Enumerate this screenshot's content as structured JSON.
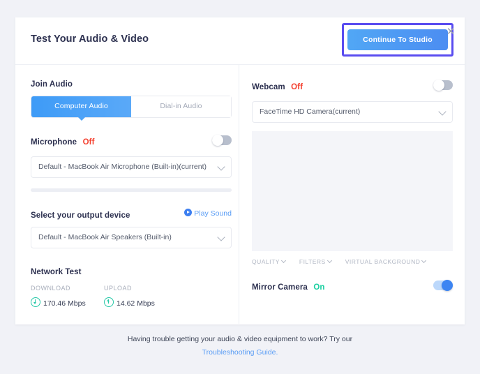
{
  "header": {
    "title": "Test Your Audio & Video",
    "continue_label": "Continue To Studio",
    "close_label": "✕",
    "highlight_color": "#5a4df0",
    "button_color": "#4c8df2"
  },
  "left_panel": {
    "join_audio_label": "Join Audio",
    "tabs": [
      {
        "label": "Computer Audio",
        "active": true
      },
      {
        "label": "Dial-in Audio",
        "active": false
      }
    ],
    "microphone": {
      "label": "Microphone",
      "status": "Off",
      "status_color": "#f4402f",
      "toggle_state": "off",
      "device": "Default - MacBook Air Microphone (Built-in)(current)"
    },
    "output": {
      "label": "Select your output device",
      "play_sound_label": "Play Sound",
      "play_icon": "play-circle-icon",
      "device": "Default - MacBook Air Speakers (Built-in)"
    },
    "network": {
      "title": "Network Test",
      "stats": [
        {
          "label": "DOWNLOAD",
          "value": "170.46 Mbps",
          "icon": "arrow-down-circle-icon",
          "color": "#29c9a8"
        },
        {
          "label": "UPLOAD",
          "value": "14.62 Mbps",
          "icon": "arrow-up-circle-icon",
          "color": "#29c9a8"
        }
      ]
    }
  },
  "right_panel": {
    "webcam": {
      "label": "Webcam",
      "status": "Off",
      "status_color": "#f4402f",
      "toggle_state": "off",
      "device": "FaceTime HD Camera(current)"
    },
    "video_controls": [
      {
        "label": "QUALITY"
      },
      {
        "label": "FILTERS"
      },
      {
        "label": "VIRTUAL BACKGROUND"
      }
    ],
    "mirror": {
      "label": "Mirror Camera",
      "status": "On",
      "status_color": "#19cfa0",
      "toggle_state": "on"
    }
  },
  "footer": {
    "text": "Having trouble getting your audio & video equipment to work? Try our",
    "link": "Troubleshooting Guide."
  }
}
